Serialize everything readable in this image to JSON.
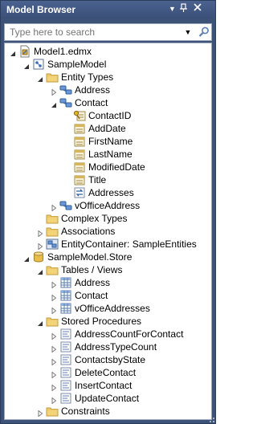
{
  "panel": {
    "title": "Model Browser",
    "dropdown_icon": "dropdown-arrow-icon",
    "pin_icon": "pin-icon",
    "close_icon": "close-icon"
  },
  "search": {
    "placeholder": "Type here to search",
    "dropdown_icon": "dropdown-arrow-icon",
    "search_icon": "search-icon"
  },
  "tree": {
    "items": [
      {
        "label": "Model1.edmx",
        "icon": "edmx-file-icon",
        "expander": "expanded"
      },
      {
        "label": "SampleModel",
        "icon": "conceptual-model-icon",
        "expander": "expanded"
      },
      {
        "label": "Entity Types",
        "icon": "folder-icon",
        "expander": "expanded"
      },
      {
        "label": "Address",
        "icon": "entity-type-icon",
        "expander": "collapsed"
      },
      {
        "label": "Contact",
        "icon": "entity-type-icon",
        "expander": "expanded"
      },
      {
        "label": "ContactID",
        "icon": "key-property-icon",
        "expander": "none"
      },
      {
        "label": "AddDate",
        "icon": "property-icon",
        "expander": "none"
      },
      {
        "label": "FirstName",
        "icon": "property-icon",
        "expander": "none"
      },
      {
        "label": "LastName",
        "icon": "property-icon",
        "expander": "none"
      },
      {
        "label": "ModifiedDate",
        "icon": "property-icon",
        "expander": "none"
      },
      {
        "label": "Title",
        "icon": "property-icon",
        "expander": "none"
      },
      {
        "label": "Addresses",
        "icon": "navigation-property-icon",
        "expander": "none"
      },
      {
        "label": "vOfficeAddress",
        "icon": "entity-type-icon",
        "expander": "collapsed"
      },
      {
        "label": "Complex Types",
        "icon": "folder-icon",
        "expander": "none"
      },
      {
        "label": "Associations",
        "icon": "folder-icon",
        "expander": "collapsed"
      },
      {
        "label": "EntityContainer: SampleEntities",
        "icon": "entity-container-icon",
        "expander": "collapsed"
      },
      {
        "label": "SampleModel.Store",
        "icon": "database-icon",
        "expander": "expanded"
      },
      {
        "label": "Tables / Views",
        "icon": "folder-icon",
        "expander": "expanded"
      },
      {
        "label": "Address",
        "icon": "table-icon",
        "expander": "collapsed"
      },
      {
        "label": "Contact",
        "icon": "table-icon",
        "expander": "collapsed"
      },
      {
        "label": "vOfficeAddresses",
        "icon": "table-icon",
        "expander": "collapsed"
      },
      {
        "label": "Stored Procedures",
        "icon": "folder-icon",
        "expander": "expanded"
      },
      {
        "label": "AddressCountForContact",
        "icon": "stored-procedure-icon",
        "expander": "collapsed"
      },
      {
        "label": "AddressTypeCount",
        "icon": "stored-procedure-icon",
        "expander": "collapsed"
      },
      {
        "label": "ContactsbyState",
        "icon": "stored-procedure-icon",
        "expander": "collapsed"
      },
      {
        "label": "DeleteContact",
        "icon": "stored-procedure-icon",
        "expander": "collapsed"
      },
      {
        "label": "InsertContact",
        "icon": "stored-procedure-icon",
        "expander": "collapsed"
      },
      {
        "label": "UpdateContact",
        "icon": "stored-procedure-icon",
        "expander": "collapsed"
      },
      {
        "label": "Constraints",
        "icon": "folder-icon",
        "expander": "collapsed"
      }
    ]
  }
}
